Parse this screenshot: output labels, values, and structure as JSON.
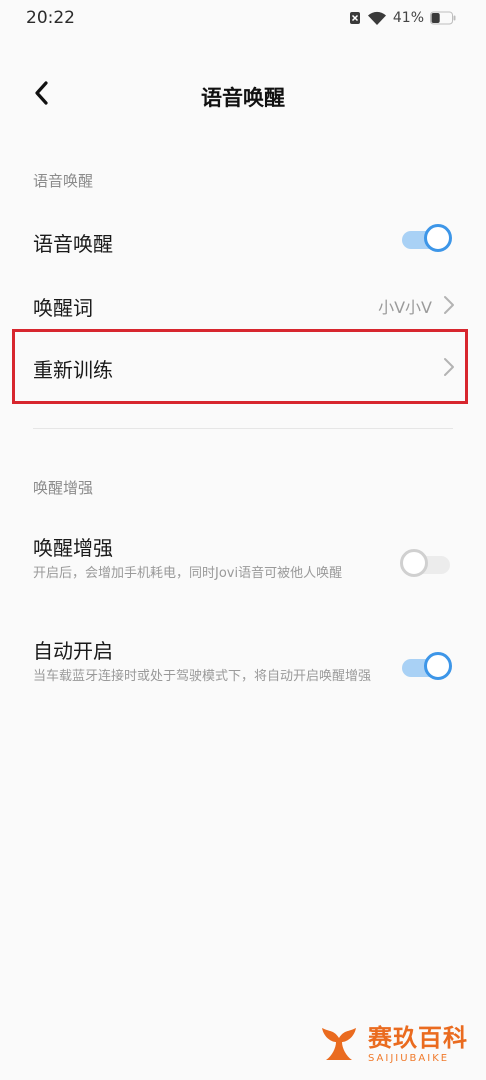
{
  "status_bar": {
    "time": "20:22",
    "battery_percent": "41%",
    "battery_level": 0.41,
    "icons": [
      "sim-off-icon",
      "wifi-icon",
      "battery-icon"
    ]
  },
  "header": {
    "title": "语音唤醒",
    "back_icon": "back-arrow-icon"
  },
  "section_voice_wake": {
    "title": "语音唤醒",
    "rows": {
      "voice_wake": {
        "label": "语音唤醒",
        "toggle_on": true
      },
      "wake_word": {
        "label": "唤醒词",
        "value": "小V小V"
      },
      "retrain": {
        "label": "重新训练"
      }
    }
  },
  "section_wake_enhance": {
    "title": "唤醒增强",
    "rows": {
      "wake_enhance": {
        "label": "唤醒增强",
        "description": "开启后，会增加手机耗电，同时Jovi语音可被他人唤醒",
        "toggle_on": false
      },
      "auto_enable": {
        "label": "自动开启",
        "description": "当车载蓝牙连接时或处于驾驶模式下，将自动开启唤醒增强",
        "toggle_on": true
      }
    }
  },
  "watermark": {
    "name": "赛玖百科",
    "subtitle": "SAIJIUBAIKE"
  },
  "colors": {
    "accent": "#3d96e8",
    "highlight": "#d7262e",
    "watermark": "#ea6b1f"
  }
}
